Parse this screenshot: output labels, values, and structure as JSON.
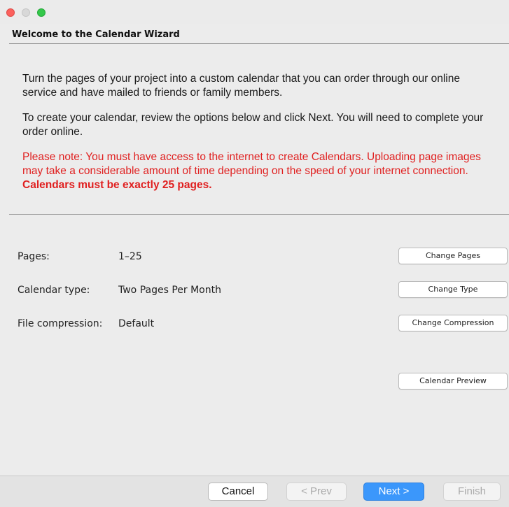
{
  "header": {
    "title": "Welcome to the Calendar Wizard"
  },
  "intro": {
    "p1": "Turn the pages of your project into a custom calendar that you can order through our online service and have mailed to friends or family members.",
    "p2": "To create your calendar, review the options below and click Next. You will need to complete your order online.",
    "note": "Please note: You must have access to the internet to create Calendars. Uploading page images may take a considerable amount of time depending on the speed of your internet connection. ",
    "note_bold": "Calendars must be exactly 25 pages."
  },
  "settings": {
    "pages_label": "Pages:",
    "pages_value": "1–25",
    "type_label": "Calendar type:",
    "type_value": "Two Pages Per Month",
    "compression_label": "File compression:",
    "compression_value": "Default"
  },
  "buttons": {
    "change_pages": "Change Pages",
    "change_type": "Change Type",
    "change_compression": "Change Compression",
    "calendar_preview": "Calendar Preview",
    "cancel": "Cancel",
    "prev": "< Prev",
    "next": "Next >",
    "finish": "Finish"
  },
  "colors": {
    "accent": "#3b97fb",
    "note_red": "#e02020"
  }
}
